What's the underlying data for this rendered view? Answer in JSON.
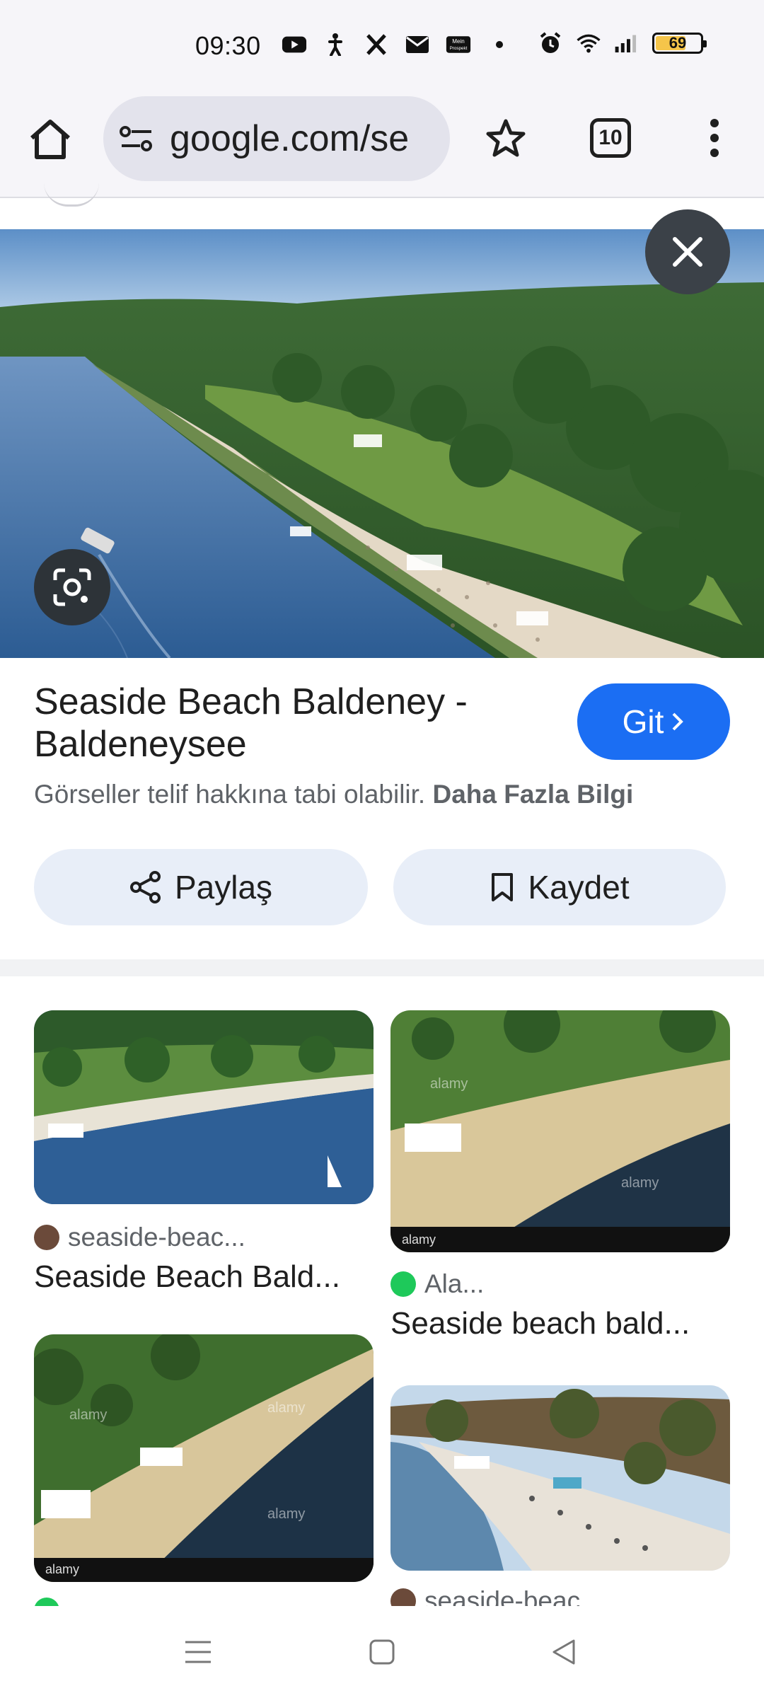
{
  "status_bar": {
    "time": "09:30",
    "notification_icons": [
      "youtube-icon",
      "accessibility-icon",
      "x-icon",
      "mail-icon",
      "mein-prospekt-icon",
      "dot-icon"
    ],
    "system_icons": [
      "alarm-icon",
      "wifi-icon",
      "signal-icon"
    ],
    "battery_percent": "69",
    "battery_level": 0.69,
    "mein_prospekt_label": "Mein Prospekt"
  },
  "browser": {
    "url": "google.com/se",
    "tab_count": "10"
  },
  "result": {
    "title": "Seaside Beach Baldeney - Baldeneysee",
    "go_label": "Git",
    "copyright_notice": "Görseller telif hakkına tabi olabilir.",
    "more_info_label": "Daha Fazla Bilgi",
    "share_label": "Paylaş",
    "save_label": "Kaydet"
  },
  "related": [
    {
      "source": "seaside-beac...",
      "title": "Seaside Beach Bald...",
      "favicon_color": "#6b4a3a"
    },
    {
      "source": "Ala...",
      "title": "Seaside beach bald...",
      "favicon_color": "#1ec95a"
    },
    {
      "source": "",
      "title": "",
      "favicon_color": "#1ec95a"
    },
    {
      "source": "seaside-beac",
      "title": "",
      "favicon_color": "#6b4a3a"
    }
  ],
  "watermark": "alamy",
  "colors": {
    "accent": "#1b6ef3",
    "chip_bg": "#e8eef8",
    "toolbar_bg": "#f6f5f9"
  }
}
